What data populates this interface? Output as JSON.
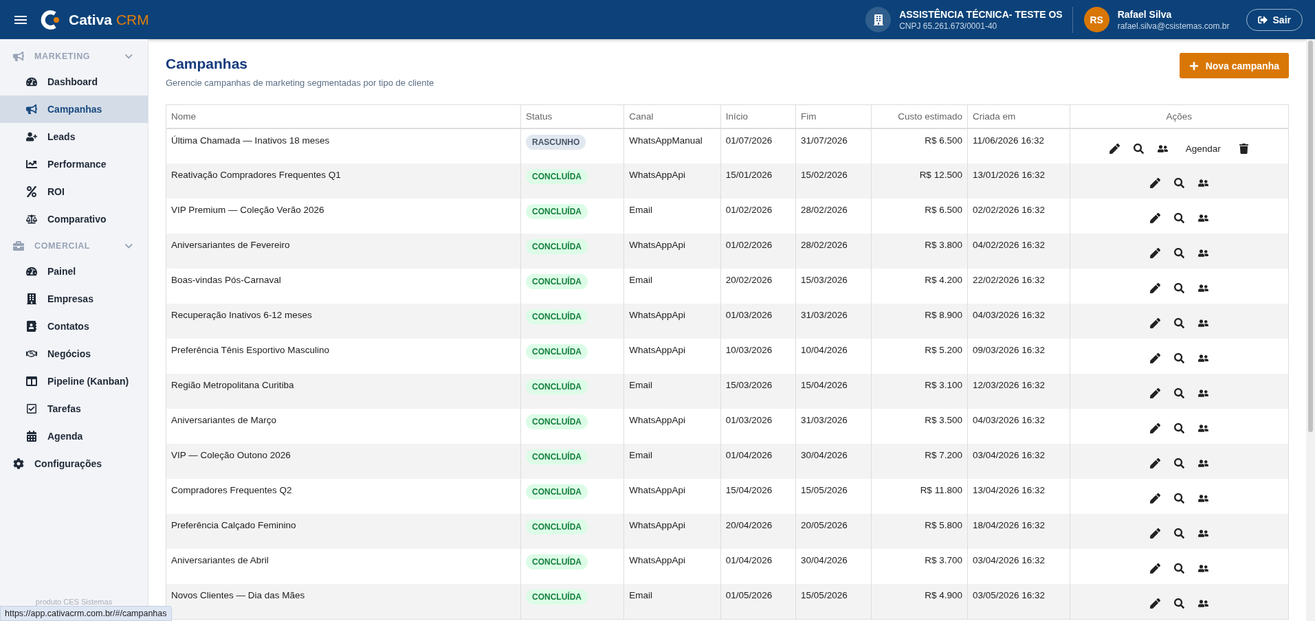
{
  "header": {
    "brand_main": "Cativa",
    "brand_accent": "CRM",
    "company": {
      "name": "ASSISTÊNCIA TÉCNICA- TESTE OS",
      "cnpj": "CNPJ 65.261.673/0001-40"
    },
    "user": {
      "initials": "RS",
      "name": "Rafael Silva",
      "email": "rafael.silva@csistemas.com.br"
    },
    "logout": "Sair"
  },
  "sidebar": {
    "sections": [
      {
        "label": "MARKETING",
        "expanded": true,
        "items": [
          {
            "label": "Dashboard",
            "selected": false
          },
          {
            "label": "Campanhas",
            "selected": true
          },
          {
            "label": "Leads",
            "selected": false
          },
          {
            "label": "Performance",
            "selected": false
          },
          {
            "label": "ROI",
            "selected": false
          },
          {
            "label": "Comparativo",
            "selected": false
          }
        ]
      },
      {
        "label": "COMERCIAL",
        "expanded": true,
        "items": [
          {
            "label": "Painel",
            "selected": false
          },
          {
            "label": "Empresas",
            "selected": false
          },
          {
            "label": "Contatos",
            "selected": false
          },
          {
            "label": "Negócios",
            "selected": false
          },
          {
            "label": "Pipeline (Kanban)",
            "selected": false
          },
          {
            "label": "Tarefas",
            "selected": false
          },
          {
            "label": "Agenda",
            "selected": false
          }
        ]
      }
    ],
    "settings": "Configurações",
    "footer": "produto CES Sistemas"
  },
  "page": {
    "title": "Campanhas",
    "subtitle": "Gerencie campanhas de marketing segmentadas por tipo de cliente",
    "new_button": "Nova campanha"
  },
  "table": {
    "columns": [
      "Nome",
      "Status",
      "Canal",
      "Início",
      "Fim",
      "Custo estimado",
      "Criada em",
      "Ações"
    ],
    "rows": [
      {
        "name": "Última Chamada — Inativos 18 meses",
        "status": {
          "kind": "draft",
          "label": "RASCUNHO"
        },
        "channel": "WhatsAppManual",
        "start": "01/07/2026",
        "end": "31/07/2026",
        "cost": "R$ 6.500",
        "created": "11/06/2026 16:32",
        "actions": [
          {
            "kind": "edit"
          },
          {
            "kind": "view"
          },
          {
            "kind": "leads"
          },
          {
            "kind": "text",
            "label": "Agendar"
          },
          {
            "kind": "delete"
          }
        ]
      },
      {
        "name": "Reativação Compradores Frequentes Q1",
        "status": {
          "kind": "done",
          "label": "CONCLUÍDA"
        },
        "channel": "WhatsAppApi",
        "start": "15/01/2026",
        "end": "15/02/2026",
        "cost": "R$ 12.500",
        "created": "13/01/2026 16:32",
        "actions": [
          {
            "kind": "edit"
          },
          {
            "kind": "view"
          },
          {
            "kind": "leads"
          }
        ]
      },
      {
        "name": "VIP Premium — Coleção Verão 2026",
        "status": {
          "kind": "done",
          "label": "CONCLUÍDA"
        },
        "channel": "Email",
        "start": "01/02/2026",
        "end": "28/02/2026",
        "cost": "R$ 6.500",
        "created": "02/02/2026 16:32",
        "actions": [
          {
            "kind": "edit"
          },
          {
            "kind": "view"
          },
          {
            "kind": "leads"
          }
        ]
      },
      {
        "name": "Aniversariantes de Fevereiro",
        "status": {
          "kind": "done",
          "label": "CONCLUÍDA"
        },
        "channel": "WhatsAppApi",
        "start": "01/02/2026",
        "end": "28/02/2026",
        "cost": "R$ 3.800",
        "created": "04/02/2026 16:32",
        "actions": [
          {
            "kind": "edit"
          },
          {
            "kind": "view"
          },
          {
            "kind": "leads"
          }
        ]
      },
      {
        "name": "Boas-vindas Pós-Carnaval",
        "status": {
          "kind": "done",
          "label": "CONCLUÍDA"
        },
        "channel": "Email",
        "start": "20/02/2026",
        "end": "15/03/2026",
        "cost": "R$ 4.200",
        "created": "22/02/2026 16:32",
        "actions": [
          {
            "kind": "edit"
          },
          {
            "kind": "view"
          },
          {
            "kind": "leads"
          }
        ]
      },
      {
        "name": "Recuperação Inativos 6-12 meses",
        "status": {
          "kind": "done",
          "label": "CONCLUÍDA"
        },
        "channel": "WhatsAppApi",
        "start": "01/03/2026",
        "end": "31/03/2026",
        "cost": "R$ 8.900",
        "created": "04/03/2026 16:32",
        "actions": [
          {
            "kind": "edit"
          },
          {
            "kind": "view"
          },
          {
            "kind": "leads"
          }
        ]
      },
      {
        "name": "Preferência Tênis Esportivo Masculino",
        "status": {
          "kind": "done",
          "label": "CONCLUÍDA"
        },
        "channel": "WhatsAppApi",
        "start": "10/03/2026",
        "end": "10/04/2026",
        "cost": "R$ 5.200",
        "created": "09/03/2026 16:32",
        "actions": [
          {
            "kind": "edit"
          },
          {
            "kind": "view"
          },
          {
            "kind": "leads"
          }
        ]
      },
      {
        "name": "Região Metropolitana Curitiba",
        "status": {
          "kind": "done",
          "label": "CONCLUÍDA"
        },
        "channel": "Email",
        "start": "15/03/2026",
        "end": "15/04/2026",
        "cost": "R$ 3.100",
        "created": "12/03/2026 16:32",
        "actions": [
          {
            "kind": "edit"
          },
          {
            "kind": "view"
          },
          {
            "kind": "leads"
          }
        ]
      },
      {
        "name": "Aniversariantes de Março",
        "status": {
          "kind": "done",
          "label": "CONCLUÍDA"
        },
        "channel": "WhatsAppApi",
        "start": "01/03/2026",
        "end": "31/03/2026",
        "cost": "R$ 3.500",
        "created": "04/03/2026 16:32",
        "actions": [
          {
            "kind": "edit"
          },
          {
            "kind": "view"
          },
          {
            "kind": "leads"
          }
        ]
      },
      {
        "name": "VIP — Coleção Outono 2026",
        "status": {
          "kind": "done",
          "label": "CONCLUÍDA"
        },
        "channel": "Email",
        "start": "01/04/2026",
        "end": "30/04/2026",
        "cost": "R$ 7.200",
        "created": "03/04/2026 16:32",
        "actions": [
          {
            "kind": "edit"
          },
          {
            "kind": "view"
          },
          {
            "kind": "leads"
          }
        ]
      },
      {
        "name": "Compradores Frequentes Q2",
        "status": {
          "kind": "done",
          "label": "CONCLUÍDA"
        },
        "channel": "WhatsAppApi",
        "start": "15/04/2026",
        "end": "15/05/2026",
        "cost": "R$ 11.800",
        "created": "13/04/2026 16:32",
        "actions": [
          {
            "kind": "edit"
          },
          {
            "kind": "view"
          },
          {
            "kind": "leads"
          }
        ]
      },
      {
        "name": "Preferência Calçado Feminino",
        "status": {
          "kind": "done",
          "label": "CONCLUÍDA"
        },
        "channel": "WhatsAppApi",
        "start": "20/04/2026",
        "end": "20/05/2026",
        "cost": "R$ 5.800",
        "created": "18/04/2026 16:32",
        "actions": [
          {
            "kind": "edit"
          },
          {
            "kind": "view"
          },
          {
            "kind": "leads"
          }
        ]
      },
      {
        "name": "Aniversariantes de Abril",
        "status": {
          "kind": "done",
          "label": "CONCLUÍDA"
        },
        "channel": "WhatsAppApi",
        "start": "01/04/2026",
        "end": "30/04/2026",
        "cost": "R$ 3.700",
        "created": "03/04/2026 16:32",
        "actions": [
          {
            "kind": "edit"
          },
          {
            "kind": "view"
          },
          {
            "kind": "leads"
          }
        ]
      },
      {
        "name": "Novos Clientes — Dia das Mães",
        "status": {
          "kind": "done",
          "label": "CONCLUÍDA"
        },
        "channel": "Email",
        "start": "01/05/2026",
        "end": "15/05/2026",
        "cost": "R$ 4.900",
        "created": "03/05/2026 16:32",
        "actions": [
          {
            "kind": "edit"
          },
          {
            "kind": "view"
          },
          {
            "kind": "leads"
          }
        ]
      }
    ]
  },
  "status_url": "https://app.cativacrm.com.br/#/campanhas"
}
